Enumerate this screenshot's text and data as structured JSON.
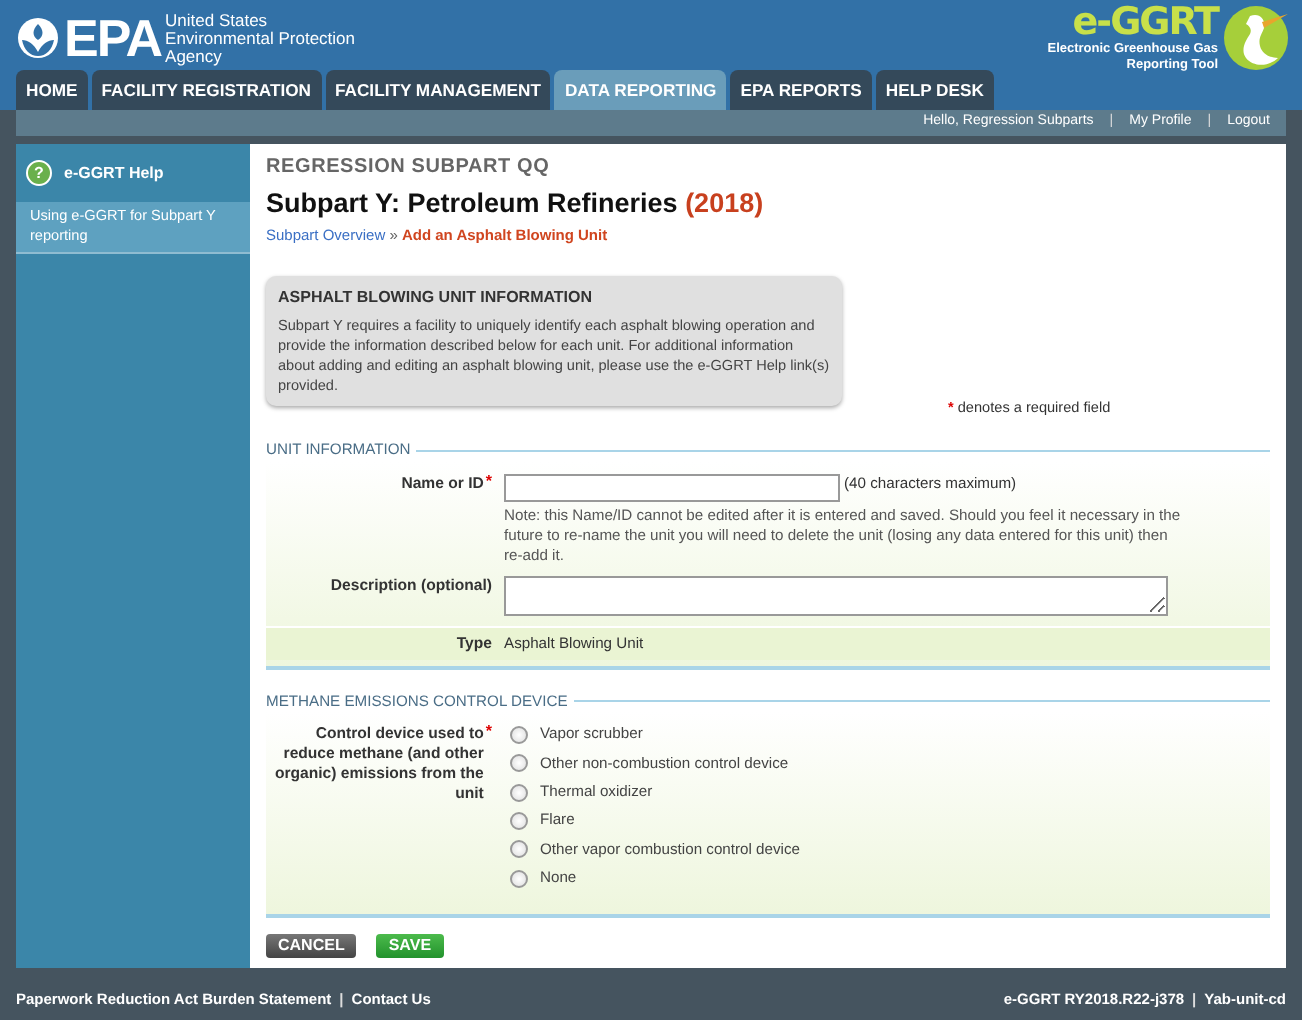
{
  "header": {
    "agency": {
      "wordmark": "EPA",
      "lines": [
        "United States",
        "Environmental Protection",
        "Agency"
      ]
    },
    "app": {
      "wordmark": "e-GGRT",
      "lines": [
        "Electronic Greenhouse Gas",
        "Reporting Tool"
      ]
    }
  },
  "tabs": [
    {
      "label": "HOME",
      "selected": false
    },
    {
      "label": "FACILITY REGISTRATION",
      "selected": false
    },
    {
      "label": "FACILITY MANAGEMENT",
      "selected": false
    },
    {
      "label": "DATA REPORTING",
      "selected": true
    },
    {
      "label": "EPA REPORTS",
      "selected": false
    },
    {
      "label": "HELP DESK",
      "selected": false
    }
  ],
  "user_links": [
    "Hello, Regression Subparts",
    "My Profile",
    "Logout"
  ],
  "separator": "|",
  "sidebar": {
    "help_icon": "?",
    "title": "e-GGRT Help",
    "items": [
      {
        "label": "Using e-GGRT for Subpart Y reporting",
        "selected": true
      }
    ]
  },
  "heading": {
    "overline": "REGRESSION SUBPART QQ",
    "title": "Subpart Y: Petroleum Refineries",
    "year": "(2018)"
  },
  "breadcrumb": [
    {
      "label": "Subpart Overview",
      "current": false
    },
    {
      "label": "»",
      "current": false
    },
    {
      "label": "Add an Asphalt Blowing Unit",
      "current": true
    }
  ],
  "info_box": {
    "title": "ASPHALT BLOWING UNIT INFORMATION",
    "text": "Subpart Y requires a facility to uniquely identify each asphalt blowing operation and provide the information described below for each unit. For additional information about adding and editing an asphalt blowing unit, please use the e-GGRT Help link(s) provided."
  },
  "required_mark": "*",
  "required_note": "denotes a required field",
  "sections": [
    {
      "title": "UNIT INFORMATION",
      "fields": [
        {
          "kind": "text",
          "label": "Name or ID",
          "required": true,
          "hint": "(40 characters maximum)",
          "note": "Note: this Name/ID cannot be edited after it is entered and saved. Should you feel it necessary in the future to re-name the unit you will need to delete the unit (losing any data entered for this unit) then re-add it."
        },
        {
          "kind": "textarea",
          "label": "Description (optional)"
        },
        {
          "kind": "static",
          "label": "Type",
          "value": "Asphalt Blowing Unit"
        }
      ]
    },
    {
      "title": "METHANE EMISSIONS CONTROL DEVICE",
      "fields": [
        {
          "kind": "radio",
          "label": "Control device used to reduce methane (and other organic) emissions from the unit",
          "required": true,
          "options": [
            {
              "label": "Vapor scrubber",
              "selected": false
            },
            {
              "label": "Other non-combustion control device",
              "selected": false
            },
            {
              "label": "Thermal oxidizer",
              "selected": false
            },
            {
              "label": "Flare",
              "selected": false
            },
            {
              "label": "Other vapor combustion control device",
              "selected": false
            },
            {
              "label": "None",
              "selected": false
            }
          ]
        }
      ]
    }
  ],
  "buttons": [
    {
      "label": "CANCEL",
      "kind": "cancel"
    },
    {
      "label": "SAVE",
      "kind": "save"
    }
  ],
  "footer": {
    "left": [
      "Paperwork Reduction Act Burden Statement",
      "Contact Us"
    ],
    "right": [
      "e-GGRT RY2018.R22-j378",
      "Yab-unit-cd"
    ]
  }
}
